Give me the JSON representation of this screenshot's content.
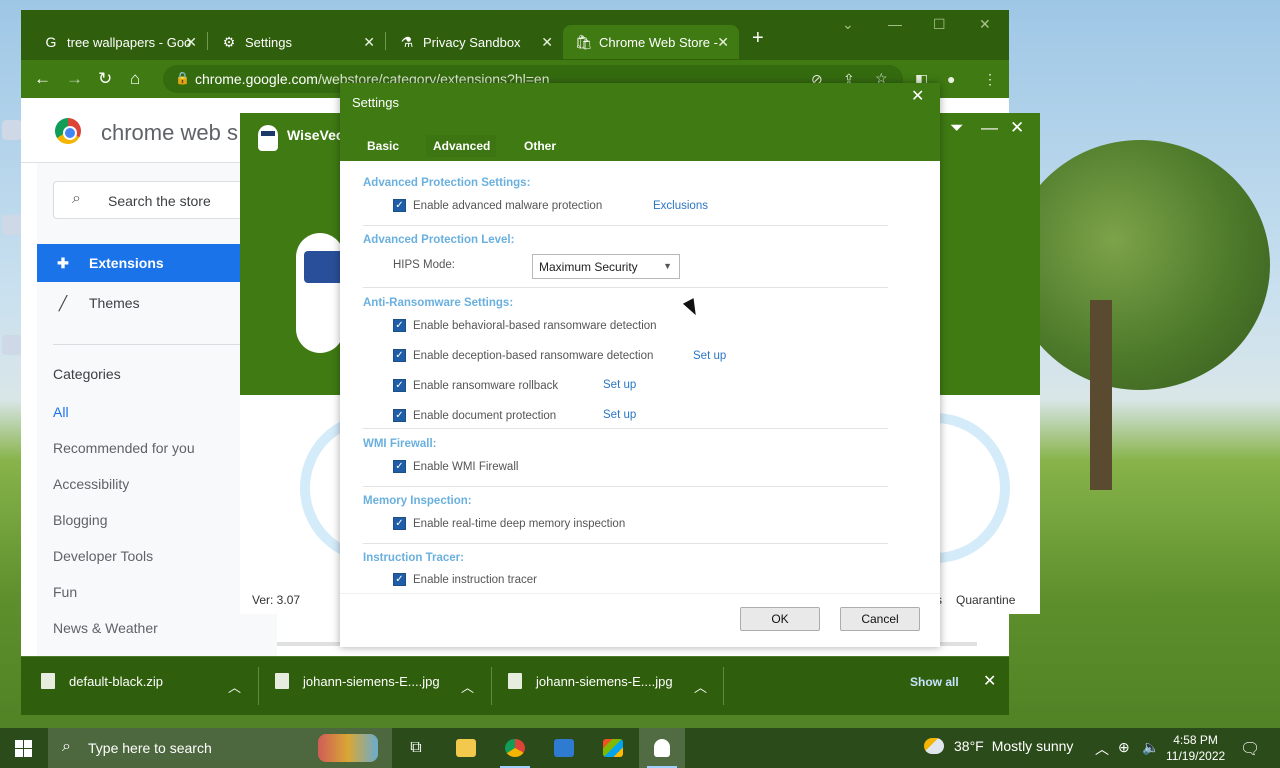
{
  "chrome": {
    "tabs": [
      {
        "label": "tree wallpapers - Goo",
        "icon": "google-icon"
      },
      {
        "label": "Settings",
        "icon": "gear-icon"
      },
      {
        "label": "Privacy Sandbox",
        "icon": "flask-icon"
      },
      {
        "label": "Chrome Web Store -",
        "icon": "webstore-icon"
      }
    ],
    "url_host": "chrome.google.com",
    "url_path": "/webstore/category/extensions?hl=en"
  },
  "store": {
    "title": "chrome web s",
    "search_placeholder": "Search the store",
    "nav": [
      {
        "label": "Extensions",
        "icon": "puzzle-icon",
        "active": true
      },
      {
        "label": "Themes",
        "icon": "brush-icon",
        "active": false
      }
    ],
    "categories_title": "Categories",
    "categories": [
      "All",
      "Recommended for you",
      "Accessibility",
      "Blogging",
      "Developer Tools",
      "Fun",
      "News & Weather"
    ]
  },
  "downloads": {
    "items": [
      "default-black.zip",
      "johann-siemens-E....jpg",
      "johann-siemens-E....jpg"
    ],
    "show_all": "Show all"
  },
  "wisevector": {
    "title": "WiseVec",
    "version": "Ver: 3.07",
    "quarantine_prefix": "s",
    "quarantine": "Quarantine"
  },
  "settings": {
    "title": "Settings",
    "tabs": [
      "Basic",
      "Advanced",
      "Other"
    ],
    "active_tab": "Advanced",
    "sections": {
      "adv_protection": "Advanced Protection Settings:",
      "adv_level": "Advanced Protection Level:",
      "ransomware": "Anti-Ransomware Settings:",
      "wmi": "WMI Firewall:",
      "memory": "Memory Inspection:",
      "tracer": "Instruction Tracer:"
    },
    "options": {
      "malware": "Enable advanced malware protection",
      "behavioral": "Enable behavioral-based ransomware detection",
      "deception": "Enable deception-based ransomware detection",
      "rollback": "Enable ransomware rollback",
      "document": "Enable document protection",
      "wmi": "Enable WMI Firewall",
      "memory": "Enable real-time deep memory inspection",
      "tracer": "Enable instruction tracer"
    },
    "links": {
      "exclusions": "Exclusions",
      "setup": "Set up"
    },
    "hips_label": "HIPS Mode:",
    "hips_value": "Maximum Security",
    "ok": "OK",
    "cancel": "Cancel"
  },
  "taskbar": {
    "search_placeholder": "Type here to search",
    "weather_temp": "38°F",
    "weather_desc": "Mostly sunny",
    "time": "4:58 PM",
    "date": "11/19/2022"
  }
}
